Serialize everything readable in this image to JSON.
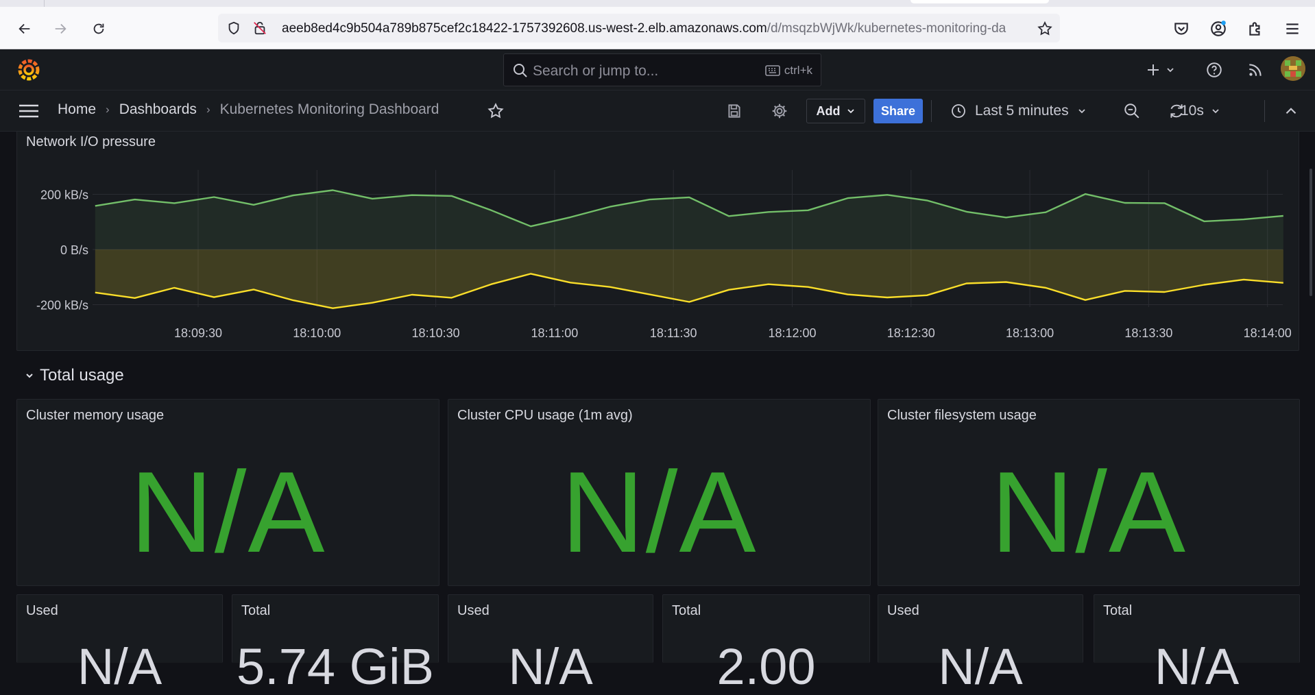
{
  "browser": {
    "url_host": "aeeb8ed4c9b504a789b875cef2c18422-1757392608.us-west-2.elb.amazonaws.com",
    "url_path": "/d/msqzbWjWk/kubernetes-monitoring-da"
  },
  "topbar": {
    "search_placeholder": "Search or jump to...",
    "search_shortcut": "ctrl+k"
  },
  "breadcrumb": {
    "home": "Home",
    "dashboards": "Dashboards",
    "current": "Kubernetes Monitoring Dashboard"
  },
  "toolbar": {
    "add_label": "Add",
    "share_label": "Share",
    "time_range": "Last 5 minutes",
    "refresh_interval": "10s"
  },
  "network_panel": {
    "title": "Network I/O pressure"
  },
  "chart_data": {
    "type": "area",
    "title": "Network I/O pressure",
    "y_ticks": [
      "200 kB/s",
      "0 B/s",
      "-200 kB/s"
    ],
    "ylim": [
      -290,
      280
    ],
    "x_ticks": [
      "18:09:30",
      "18:10:00",
      "18:10:30",
      "18:11:00",
      "18:11:30",
      "18:12:00",
      "18:12:30",
      "18:13:00",
      "18:13:30",
      "18:14:00"
    ],
    "x_start": "18:09:04",
    "x_step_seconds": 10,
    "series": [
      {
        "color": "#73bf69",
        "values": [
          158,
          181,
          168,
          190,
          162,
          196,
          215,
          184,
          197,
          194,
          142,
          84,
          117,
          155,
          181,
          189,
          121,
          136,
          142,
          186,
          198,
          178,
          137,
          116,
          135,
          201,
          169,
          168,
          102,
          109,
          122
        ]
      },
      {
        "color": "#fade2a",
        "values": [
          -156,
          -176,
          -139,
          -173,
          -145,
          -184,
          -213,
          -193,
          -164,
          -175,
          -126,
          -88,
          -120,
          -136,
          -163,
          -190,
          -146,
          -126,
          -136,
          -163,
          -174,
          -166,
          -123,
          -118,
          -139,
          -183,
          -150,
          -154,
          -128,
          -109,
          -121
        ]
      }
    ]
  },
  "row": {
    "title": "Total usage"
  },
  "stat_panels": [
    {
      "title": "Cluster memory usage",
      "value": "N/A"
    },
    {
      "title": "Cluster CPU usage (1m avg)",
      "value": "N/A"
    },
    {
      "title": "Cluster filesystem usage",
      "value": "N/A"
    }
  ],
  "small_panels": [
    {
      "title": "Used",
      "value": "N/A"
    },
    {
      "title": "Total",
      "value": "5.74 GiB"
    },
    {
      "title": "Used",
      "value": "N/A"
    },
    {
      "title": "Total",
      "value": "2.00"
    },
    {
      "title": "Used",
      "value": "N/A"
    },
    {
      "title": "Total",
      "value": "N/A"
    }
  ]
}
